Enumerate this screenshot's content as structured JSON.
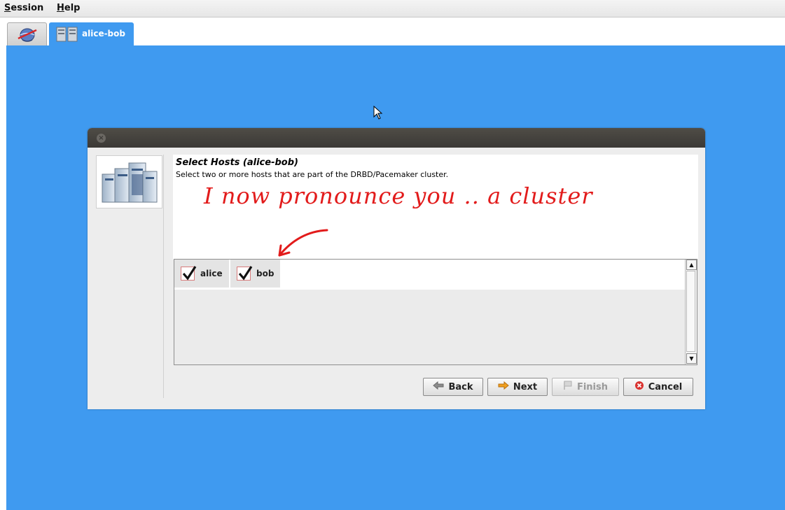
{
  "menu": {
    "session_label": "Session",
    "help_label": "Help"
  },
  "tabs": [
    {
      "label": "",
      "icon": "network-globe-icon"
    },
    {
      "label": "alice-bob",
      "icon": "servers-icon",
      "color": "#3f9af0"
    }
  ],
  "dialog": {
    "title": "Select Hosts (alice-bob)",
    "description": "Select two or more hosts that are part of the DRBD/Pacemaker cluster.",
    "annotation": "I now pronounce you .. a cluster",
    "hosts": [
      {
        "name": "alice",
        "checked": true
      },
      {
        "name": "bob",
        "checked": true
      }
    ],
    "buttons": {
      "back": "Back",
      "next": "Next",
      "finish": "Finish",
      "cancel": "Cancel"
    }
  },
  "colors": {
    "accent": "#3f9af0",
    "annotation": "#e21b1b",
    "titlebar": "#3b3936"
  }
}
